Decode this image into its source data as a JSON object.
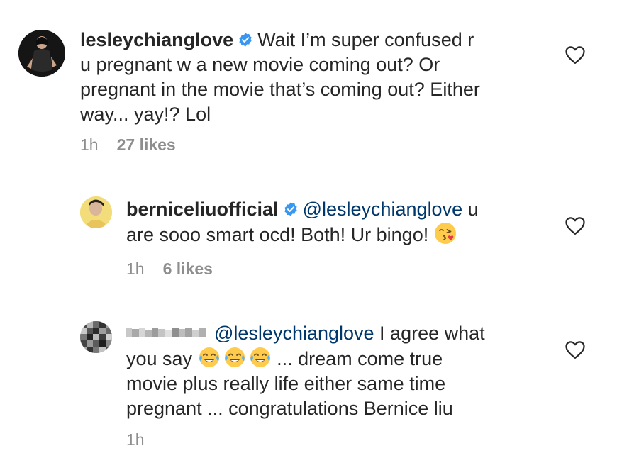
{
  "comments": [
    {
      "username": "lesleychianglove",
      "verified": true,
      "line1": "Wait I’m super confused r",
      "line2": "u pregnant w a new movie coming out? Or",
      "line3": "pregnant in the movie that’s coming out? Either",
      "line4": "way... yay!? Lol",
      "time": "1h",
      "likes": "27 likes"
    },
    {
      "username": "berniceliuofficial",
      "verified": true,
      "mention": "@lesleychianglove",
      "line1_rest": " u",
      "line2": "are sooo smart ocd!  Both! Ur bingo!",
      "time": "1h",
      "likes": "6 likes"
    },
    {
      "username": "(blurred)",
      "mention": "@lesleychianglove",
      "line1_rest": " I agree what",
      "line2_a": "you say",
      "line2_b": " ... dream come true",
      "line3": "movie plus really life either same time",
      "line4": "pregnant ... congratulations Bernice liu",
      "time": "1h"
    }
  ],
  "icons": {
    "heart": "heart-outline-icon",
    "verified": "verified-badge-icon",
    "emoji_kiss": "face-blowing-kiss-emoji",
    "emoji_laugh": "face-with-tears-of-joy-emoji"
  },
  "colors": {
    "text": "#262626",
    "meta": "#8e8e8e",
    "mention": "#00376b",
    "verified": "#3897f0"
  }
}
